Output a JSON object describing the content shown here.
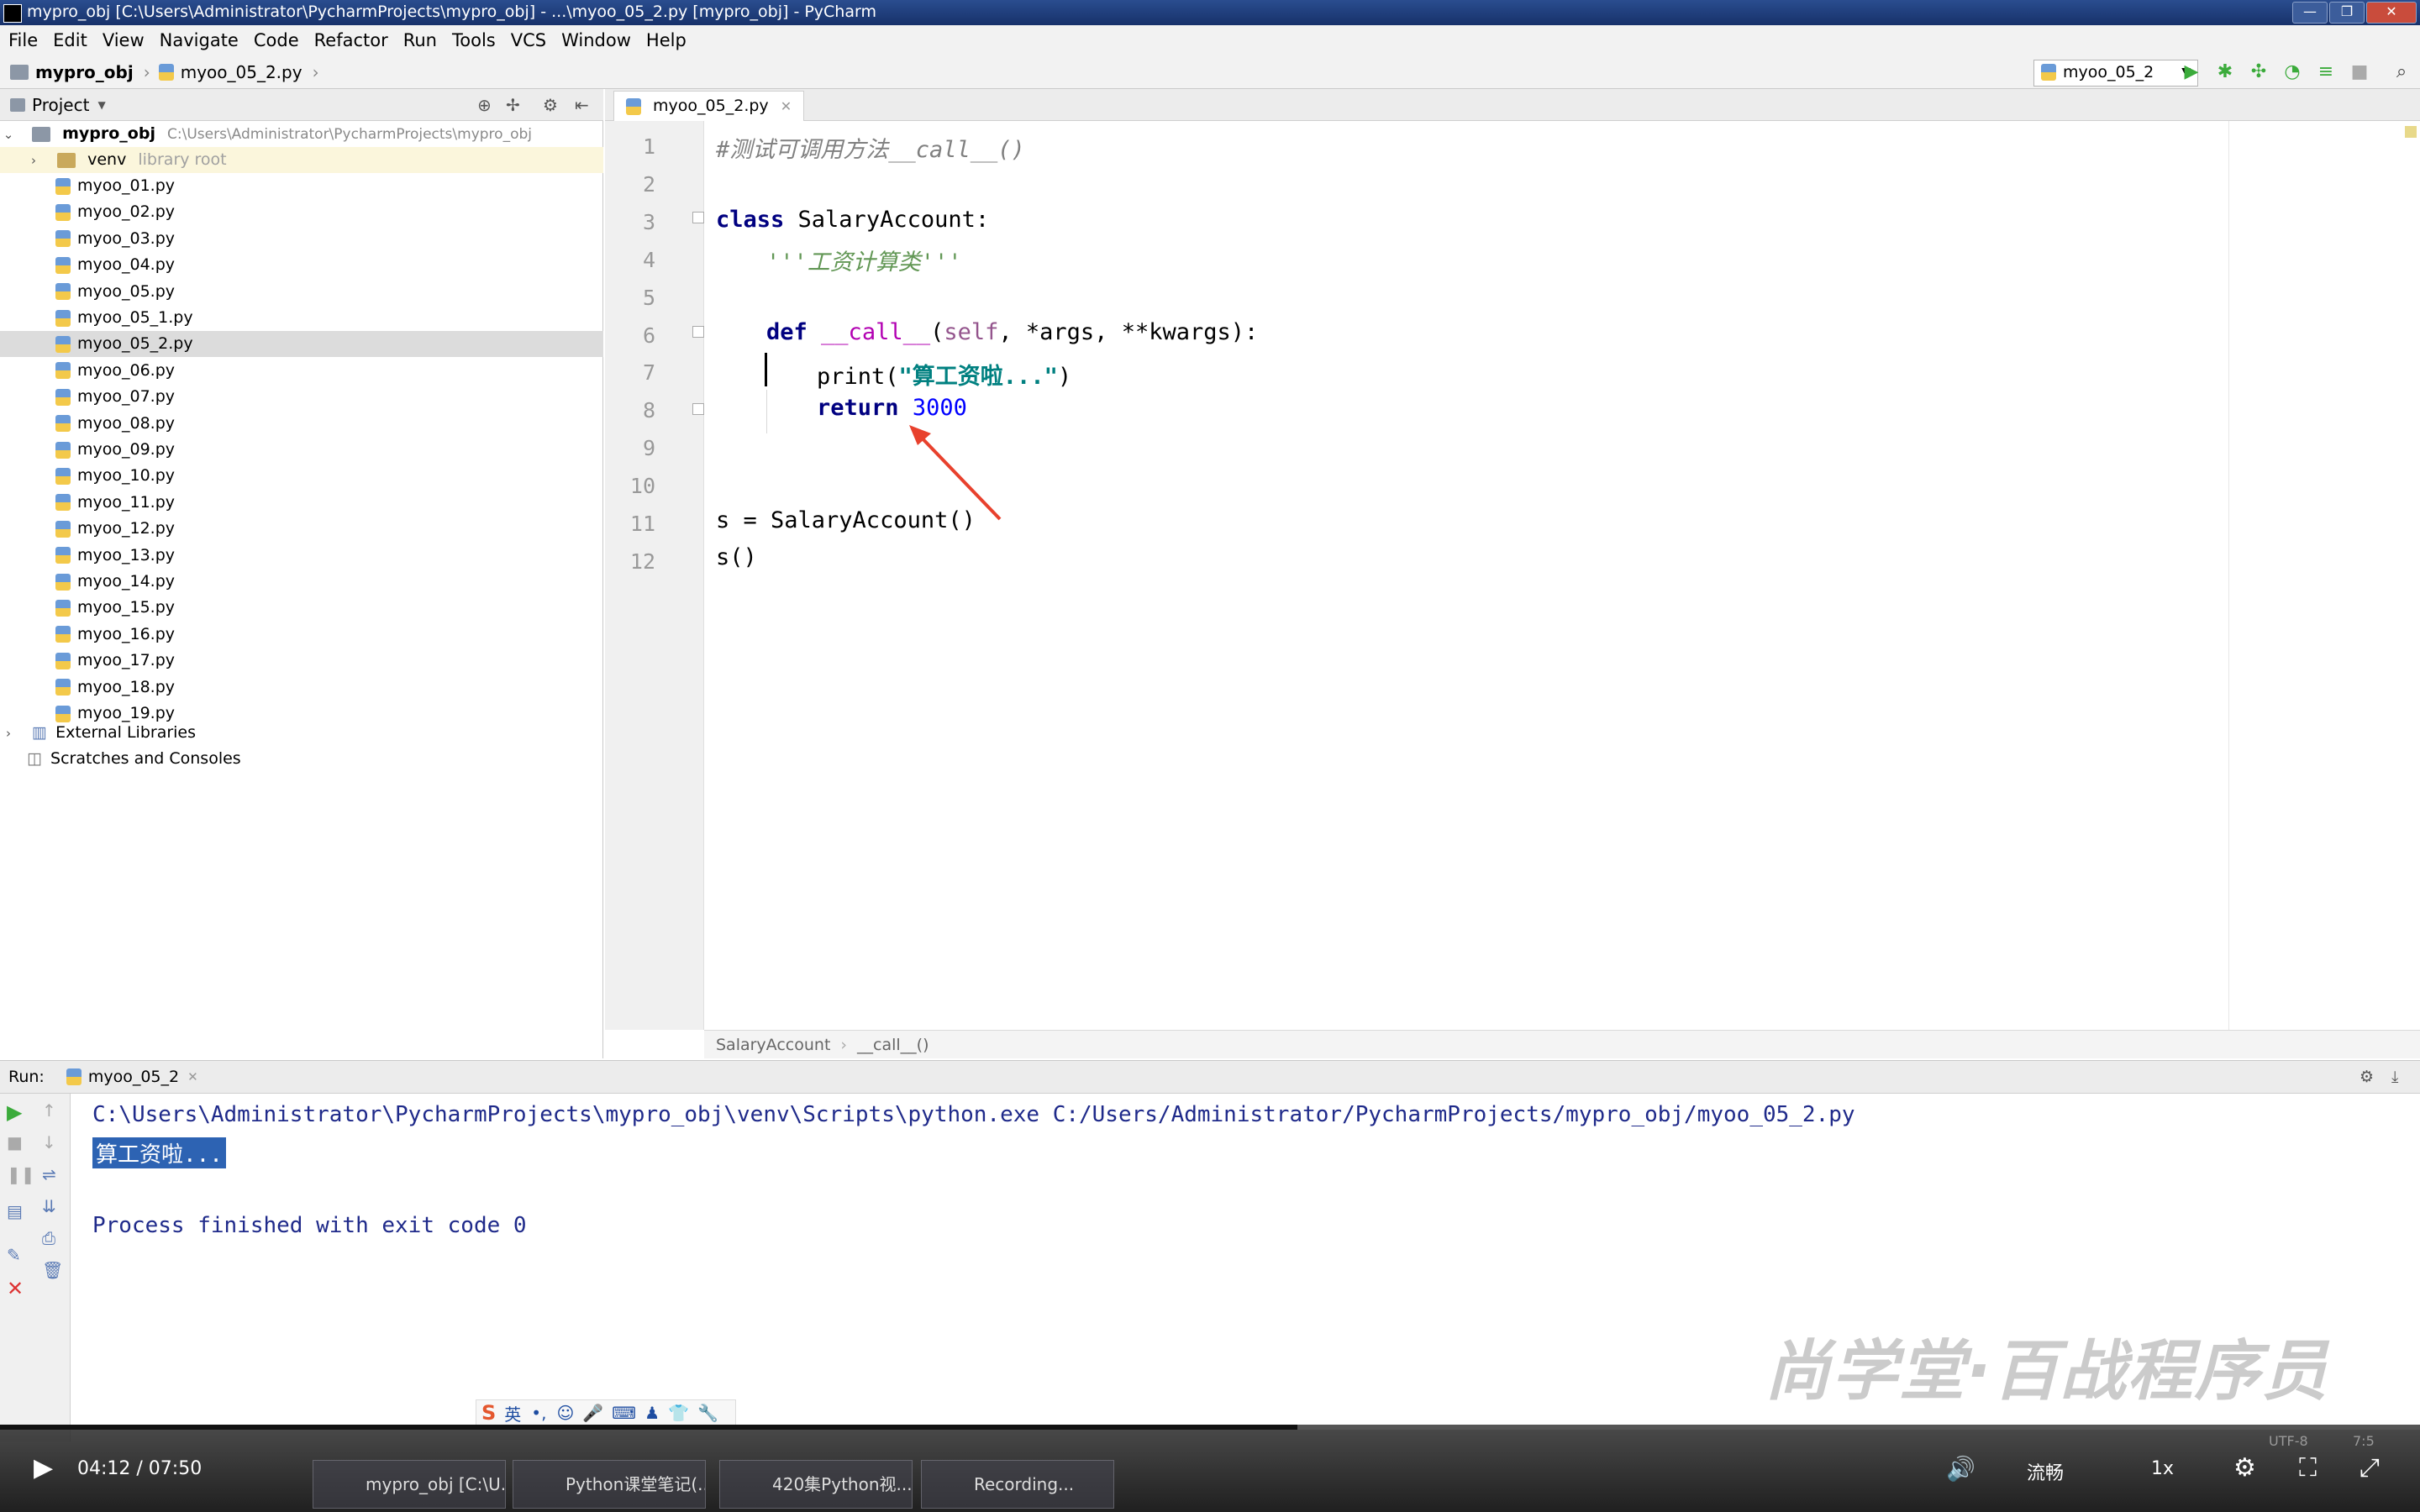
{
  "window": {
    "title": "mypro_obj [C:\\Users\\Administrator\\PycharmProjects\\mypro_obj] - ...\\myoo_05_2.py [mypro_obj] - PyCharm"
  },
  "menu": [
    "File",
    "Edit",
    "View",
    "Navigate",
    "Code",
    "Refactor",
    "Run",
    "Tools",
    "VCS",
    "Window",
    "Help"
  ],
  "navbar": {
    "project": "mypro_obj",
    "file": "myoo_05_2.py",
    "run_config": "myoo_05_2"
  },
  "project_panel": {
    "title": "Project",
    "root_name": "mypro_obj",
    "root_path": "C:\\Users\\Administrator\\PycharmProjects\\mypro_obj",
    "venv": "venv",
    "venv_note": "library root",
    "files": [
      "myoo_01.py",
      "myoo_02.py",
      "myoo_03.py",
      "myoo_04.py",
      "myoo_05.py",
      "myoo_05_1.py",
      "myoo_05_2.py",
      "myoo_06.py",
      "myoo_07.py",
      "myoo_08.py",
      "myoo_09.py",
      "myoo_10.py",
      "myoo_11.py",
      "myoo_12.py",
      "myoo_13.py",
      "myoo_14.py",
      "myoo_15.py",
      "myoo_16.py",
      "myoo_17.py",
      "myoo_18.py",
      "myoo_19.py"
    ],
    "selected_file": "myoo_05_2.py",
    "external_libraries": "External Libraries",
    "scratches": "Scratches and Consoles"
  },
  "editor": {
    "tab": "myoo_05_2.py",
    "line_numbers": [
      "1",
      "2",
      "3",
      "4",
      "5",
      "6",
      "7",
      "8",
      "9",
      "10",
      "11",
      "12"
    ],
    "code": {
      "l1": "#测试可调用方法__call__()",
      "l3_kw": "class",
      "l3_rest": " SalaryAccount:",
      "l4": "'''工资计算类'''",
      "l6_kw": "def",
      "l6_name": "__call__",
      "l6_open": "(",
      "l6_self": "self",
      "l6_rest": ", *args, **kwargs):",
      "l7_fn": "print(",
      "l7_str": "\"算工资啦...\"",
      "l7_close": ")",
      "l8_kw": "return",
      "l8_num": "3000",
      "l11": "s = SalaryAccount()",
      "l12": "s()"
    },
    "breadcrumb": [
      "SalaryAccount",
      "__call__()"
    ]
  },
  "run_panel": {
    "label": "Run:",
    "tab": "myoo_05_2",
    "lines": {
      "cmd": "C:\\Users\\Administrator\\PycharmProjects\\mypro_obj\\venv\\Scripts\\python.exe C:/Users/Administrator/PycharmProjects/mypro_obj/myoo_05_2.py",
      "out": "算工资啦...",
      "exit": "Process finished with exit code 0"
    }
  },
  "video_player": {
    "time": "04:12 / 07:50",
    "progress": 0.536,
    "quality": "流畅",
    "speed": "1x"
  },
  "taskbar": [
    "mypro_obj [C:\\U...",
    "Python课堂笔记(...",
    "420集Python视...",
    "Recording..."
  ],
  "ime_label": "英",
  "watermark": "尚学堂·百战程序员",
  "status": {
    "pos": "7:5",
    "encoding": "UTF-8"
  },
  "colors": {
    "accent": "#2d63b3",
    "annotation_arrow": "#e8412d"
  }
}
